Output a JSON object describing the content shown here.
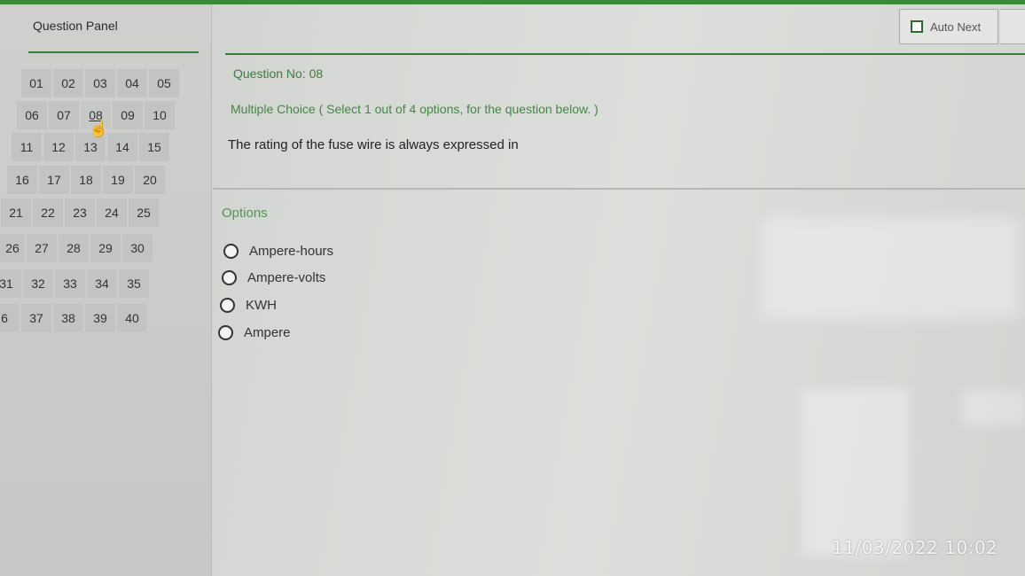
{
  "panel": {
    "title": "Question Panel",
    "rows": [
      [
        "01",
        "02",
        "03",
        "04",
        "05"
      ],
      [
        "06",
        "07",
        "08",
        "09",
        "10"
      ],
      [
        "11",
        "12",
        "13",
        "14",
        "15"
      ],
      [
        "16",
        "17",
        "18",
        "19",
        "20"
      ],
      [
        "21",
        "22",
        "23",
        "24",
        "25"
      ],
      [
        "26",
        "27",
        "28",
        "29",
        "30"
      ],
      [
        "31",
        "32",
        "33",
        "34",
        "35"
      ],
      [
        "6",
        "37",
        "38",
        "39",
        "40"
      ]
    ],
    "current": "08"
  },
  "toolbar": {
    "auto_next_label": "Auto Next"
  },
  "question": {
    "number_label": "Question No: 08",
    "type_label": "Multiple Choice ( Select 1 out of 4 options, for the question below. )",
    "text": "The rating of the fuse wire is always expressed in"
  },
  "options": {
    "label": "Options",
    "items": [
      "Ampere-hours",
      "Ampere-volts",
      "KWH",
      "Ampere"
    ]
  },
  "overlay": {
    "timestamp": "11/03/2022 10:02"
  },
  "colors": {
    "accent": "#3a7d3a",
    "top_bar": "#3a8a3a"
  }
}
